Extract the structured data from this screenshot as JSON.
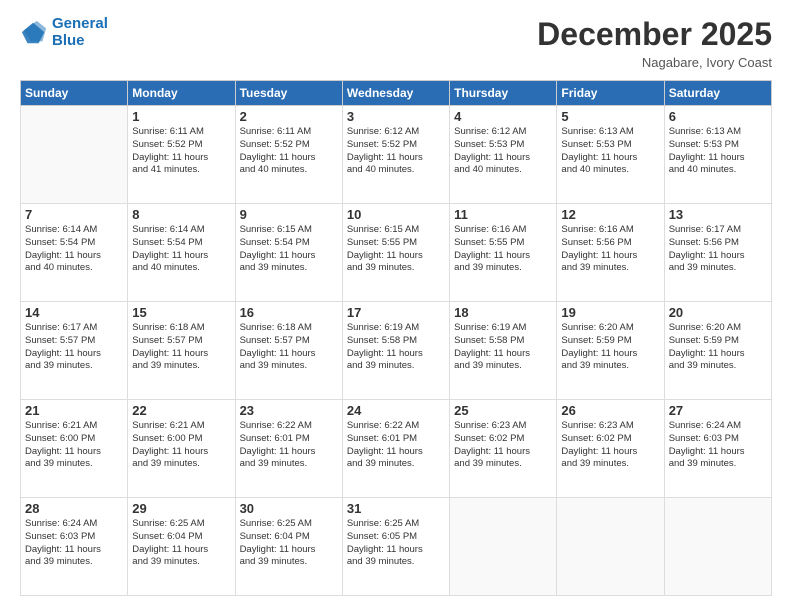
{
  "header": {
    "logo_line1": "General",
    "logo_line2": "Blue",
    "month": "December 2025",
    "location": "Nagabare, Ivory Coast"
  },
  "weekdays": [
    "Sunday",
    "Monday",
    "Tuesday",
    "Wednesday",
    "Thursday",
    "Friday",
    "Saturday"
  ],
  "weeks": [
    [
      {
        "day": "",
        "info": ""
      },
      {
        "day": "1",
        "info": "Sunrise: 6:11 AM\nSunset: 5:52 PM\nDaylight: 11 hours\nand 41 minutes."
      },
      {
        "day": "2",
        "info": "Sunrise: 6:11 AM\nSunset: 5:52 PM\nDaylight: 11 hours\nand 40 minutes."
      },
      {
        "day": "3",
        "info": "Sunrise: 6:12 AM\nSunset: 5:52 PM\nDaylight: 11 hours\nand 40 minutes."
      },
      {
        "day": "4",
        "info": "Sunrise: 6:12 AM\nSunset: 5:53 PM\nDaylight: 11 hours\nand 40 minutes."
      },
      {
        "day": "5",
        "info": "Sunrise: 6:13 AM\nSunset: 5:53 PM\nDaylight: 11 hours\nand 40 minutes."
      },
      {
        "day": "6",
        "info": "Sunrise: 6:13 AM\nSunset: 5:53 PM\nDaylight: 11 hours\nand 40 minutes."
      }
    ],
    [
      {
        "day": "7",
        "info": "Sunrise: 6:14 AM\nSunset: 5:54 PM\nDaylight: 11 hours\nand 40 minutes."
      },
      {
        "day": "8",
        "info": "Sunrise: 6:14 AM\nSunset: 5:54 PM\nDaylight: 11 hours\nand 40 minutes."
      },
      {
        "day": "9",
        "info": "Sunrise: 6:15 AM\nSunset: 5:54 PM\nDaylight: 11 hours\nand 39 minutes."
      },
      {
        "day": "10",
        "info": "Sunrise: 6:15 AM\nSunset: 5:55 PM\nDaylight: 11 hours\nand 39 minutes."
      },
      {
        "day": "11",
        "info": "Sunrise: 6:16 AM\nSunset: 5:55 PM\nDaylight: 11 hours\nand 39 minutes."
      },
      {
        "day": "12",
        "info": "Sunrise: 6:16 AM\nSunset: 5:56 PM\nDaylight: 11 hours\nand 39 minutes."
      },
      {
        "day": "13",
        "info": "Sunrise: 6:17 AM\nSunset: 5:56 PM\nDaylight: 11 hours\nand 39 minutes."
      }
    ],
    [
      {
        "day": "14",
        "info": "Sunrise: 6:17 AM\nSunset: 5:57 PM\nDaylight: 11 hours\nand 39 minutes."
      },
      {
        "day": "15",
        "info": "Sunrise: 6:18 AM\nSunset: 5:57 PM\nDaylight: 11 hours\nand 39 minutes."
      },
      {
        "day": "16",
        "info": "Sunrise: 6:18 AM\nSunset: 5:57 PM\nDaylight: 11 hours\nand 39 minutes."
      },
      {
        "day": "17",
        "info": "Sunrise: 6:19 AM\nSunset: 5:58 PM\nDaylight: 11 hours\nand 39 minutes."
      },
      {
        "day": "18",
        "info": "Sunrise: 6:19 AM\nSunset: 5:58 PM\nDaylight: 11 hours\nand 39 minutes."
      },
      {
        "day": "19",
        "info": "Sunrise: 6:20 AM\nSunset: 5:59 PM\nDaylight: 11 hours\nand 39 minutes."
      },
      {
        "day": "20",
        "info": "Sunrise: 6:20 AM\nSunset: 5:59 PM\nDaylight: 11 hours\nand 39 minutes."
      }
    ],
    [
      {
        "day": "21",
        "info": "Sunrise: 6:21 AM\nSunset: 6:00 PM\nDaylight: 11 hours\nand 39 minutes."
      },
      {
        "day": "22",
        "info": "Sunrise: 6:21 AM\nSunset: 6:00 PM\nDaylight: 11 hours\nand 39 minutes."
      },
      {
        "day": "23",
        "info": "Sunrise: 6:22 AM\nSunset: 6:01 PM\nDaylight: 11 hours\nand 39 minutes."
      },
      {
        "day": "24",
        "info": "Sunrise: 6:22 AM\nSunset: 6:01 PM\nDaylight: 11 hours\nand 39 minutes."
      },
      {
        "day": "25",
        "info": "Sunrise: 6:23 AM\nSunset: 6:02 PM\nDaylight: 11 hours\nand 39 minutes."
      },
      {
        "day": "26",
        "info": "Sunrise: 6:23 AM\nSunset: 6:02 PM\nDaylight: 11 hours\nand 39 minutes."
      },
      {
        "day": "27",
        "info": "Sunrise: 6:24 AM\nSunset: 6:03 PM\nDaylight: 11 hours\nand 39 minutes."
      }
    ],
    [
      {
        "day": "28",
        "info": "Sunrise: 6:24 AM\nSunset: 6:03 PM\nDaylight: 11 hours\nand 39 minutes."
      },
      {
        "day": "29",
        "info": "Sunrise: 6:25 AM\nSunset: 6:04 PM\nDaylight: 11 hours\nand 39 minutes."
      },
      {
        "day": "30",
        "info": "Sunrise: 6:25 AM\nSunset: 6:04 PM\nDaylight: 11 hours\nand 39 minutes."
      },
      {
        "day": "31",
        "info": "Sunrise: 6:25 AM\nSunset: 6:05 PM\nDaylight: 11 hours\nand 39 minutes."
      },
      {
        "day": "",
        "info": ""
      },
      {
        "day": "",
        "info": ""
      },
      {
        "day": "",
        "info": ""
      }
    ]
  ]
}
